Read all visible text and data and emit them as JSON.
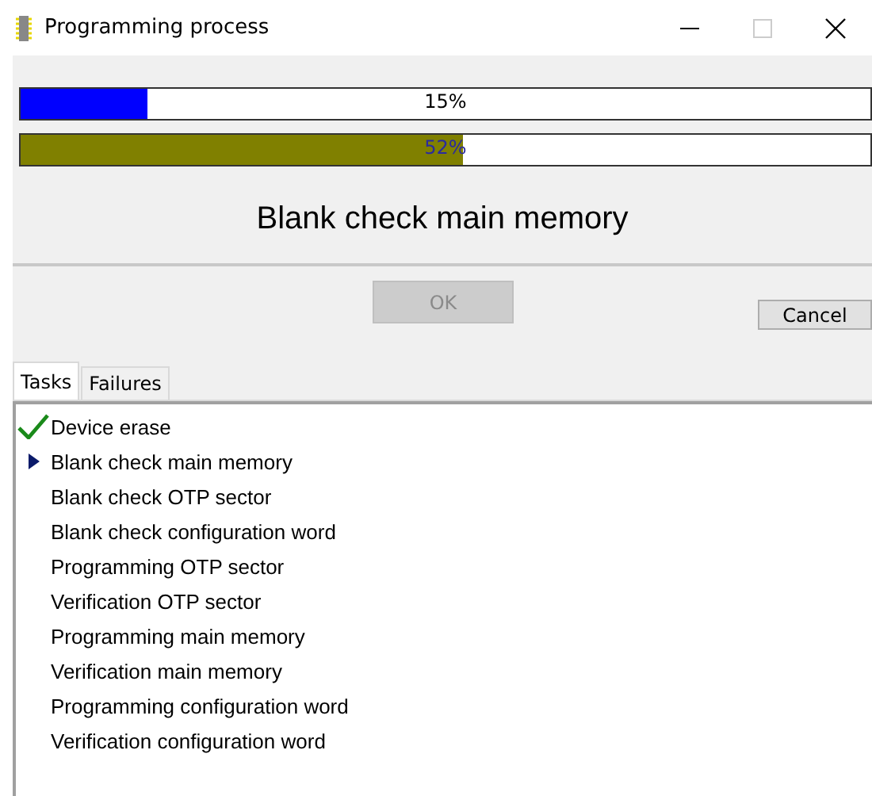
{
  "window": {
    "title": "Programming process"
  },
  "progress": [
    {
      "reading": "15%",
      "level": 0.15,
      "color": "#0000ff"
    },
    {
      "reading": "52%",
      "level": 0.52,
      "color": "#808000"
    }
  ],
  "heading": "Blank check main memory",
  "buttons": {
    "ok": {
      "label": "OK",
      "disabled": true
    },
    "cancel": {
      "label": "Cancel",
      "disabled": false
    }
  },
  "tabs": [
    {
      "label": "Tasks",
      "selected": true
    },
    {
      "label": "Failures",
      "selected": false
    }
  ],
  "tasks": [
    {
      "label": "Device erase",
      "kind": "done"
    },
    {
      "label": "Blank check main memory",
      "kind": "current"
    },
    {
      "label": "Blank check OTP sector",
      "kind": "pending"
    },
    {
      "label": "Blank check configuration word",
      "kind": "pending"
    },
    {
      "label": "Programming OTP sector",
      "kind": "pending"
    },
    {
      "label": "Verification OTP sector",
      "kind": "pending"
    },
    {
      "label": "Programming main memory",
      "kind": "pending"
    },
    {
      "label": "Verification main memory",
      "kind": "pending"
    },
    {
      "label": "Programming configuration word",
      "kind": "pending"
    },
    {
      "label": "Verification configuration word",
      "kind": "pending"
    }
  ]
}
